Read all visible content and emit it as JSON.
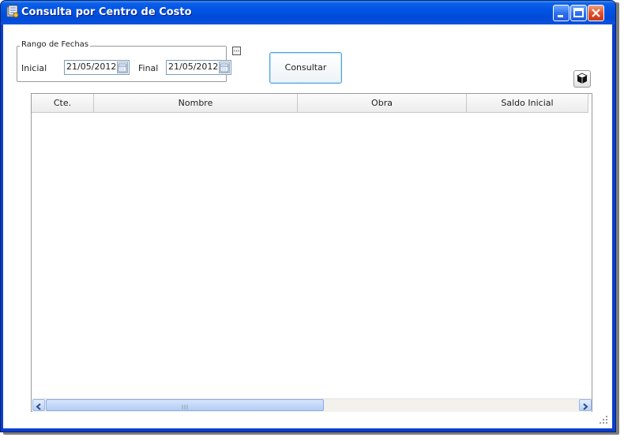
{
  "window": {
    "title": "Consulta por Centro de Costo",
    "buttons": [
      "minimize",
      "maximize",
      "close"
    ]
  },
  "date_range": {
    "group_label": "Rango de Fechas",
    "start_label": "Inicial",
    "start_value": "21/05/2012",
    "end_label": "Final",
    "end_value": "21/05/2012",
    "more_button": "..."
  },
  "toolbar": {
    "consult_label": "Consultar",
    "export_icon": "cube-icon"
  },
  "grid": {
    "columns": [
      "Cte.",
      "Nombre",
      "Obra",
      "Saldo Inicial"
    ],
    "rows": [],
    "scrollbar_thumb_fraction": 0.5
  },
  "colors": {
    "titlebar": "#0054e3",
    "frame": "#0a3fd0",
    "button_border": "#4aa3d8"
  }
}
